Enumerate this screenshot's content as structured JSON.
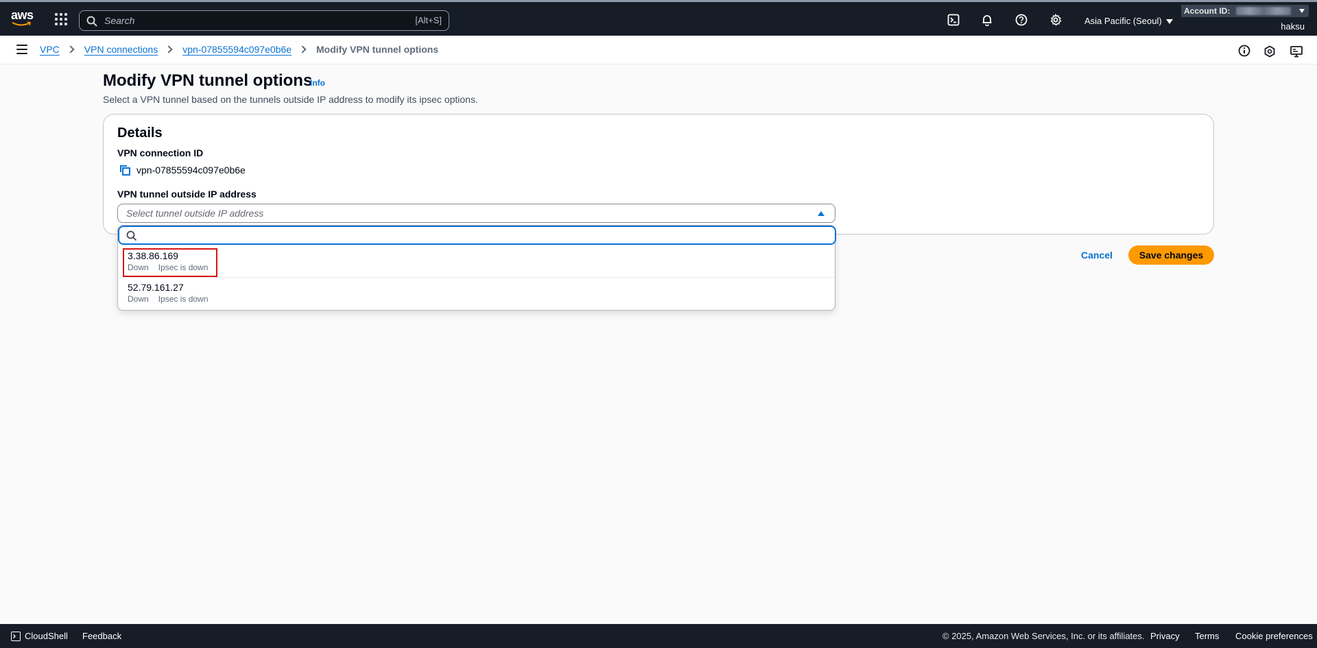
{
  "topnav": {
    "logo_text": "aws",
    "search_placeholder": "Search",
    "search_shortcut": "[Alt+S]",
    "region": "Asia Pacific (Seoul)",
    "account_label": "Account ID:",
    "user": "haksu",
    "icons": [
      "cloudshell-icon",
      "bell-icon",
      "help-icon",
      "settings-icon"
    ]
  },
  "breadcrumb": {
    "items": [
      "VPC",
      "VPN connections",
      "vpn-07855594c097e0b6e"
    ],
    "current": "Modify VPN tunnel options"
  },
  "page": {
    "title": "Modify VPN tunnel options",
    "info_link": "Info",
    "description": "Select a VPN tunnel based on the tunnels outside IP address to modify its ipsec options."
  },
  "details": {
    "title": "Details",
    "connection_id_label": "VPN connection ID",
    "connection_id_value": "vpn-07855594c097e0b6e",
    "tunnel_ip_label": "VPN tunnel outside IP address",
    "tunnel_ip_placeholder": "Select tunnel outside IP address",
    "filter_value": "",
    "options": [
      {
        "ip": "3.38.86.169",
        "status": "Down",
        "ipsec": "Ipsec is down"
      },
      {
        "ip": "52.79.161.27",
        "status": "Down",
        "ipsec": "Ipsec is down"
      }
    ]
  },
  "actions": {
    "cancel": "Cancel",
    "save": "Save changes"
  },
  "footer": {
    "cloudshell": "CloudShell",
    "feedback": "Feedback",
    "copyright": "© 2025, Amazon Web Services, Inc. or its affiliates.",
    "privacy": "Privacy",
    "terms": "Terms",
    "cookie": "Cookie preferences"
  },
  "colors": {
    "nav_bg": "#161d26",
    "link": "#0972d3",
    "primary_button": "#ff9900",
    "highlight": "#d91515"
  }
}
